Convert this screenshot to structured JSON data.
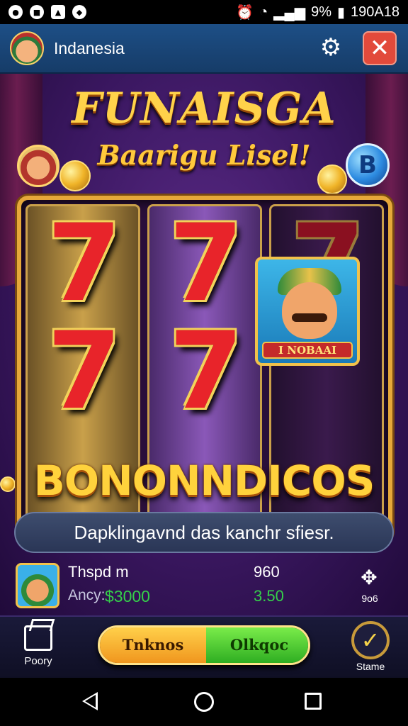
{
  "status_bar": {
    "battery": "9%",
    "time": "190A18"
  },
  "header": {
    "title": "Indanesia"
  },
  "game": {
    "title": "FUNAISGA",
    "subtitle": "Baarigu Lisel!",
    "token_letter": "B",
    "reels": [
      [
        "7",
        "7"
      ],
      [
        "7",
        "7"
      ],
      [
        "7"
      ]
    ],
    "character_label": "I NOBAAI",
    "bonus_text": "BONONNDICOS",
    "message": "Dapklingavnd das kanchr sfiesr."
  },
  "info": {
    "name": "Thspd m",
    "label": "Ancy:",
    "amount": "$3000",
    "value1": "960",
    "value2": "3.50",
    "move_label": "9o6"
  },
  "bottom_bar": {
    "left_label": "Poory",
    "action_left": "Tnknos",
    "action_right": "Olkqoc",
    "right_label": "Stame"
  },
  "colors": {
    "header_bg": "#1d4f86",
    "gold": "#ffd23c",
    "green": "#35d04a",
    "close_red": "#e24a3b"
  }
}
